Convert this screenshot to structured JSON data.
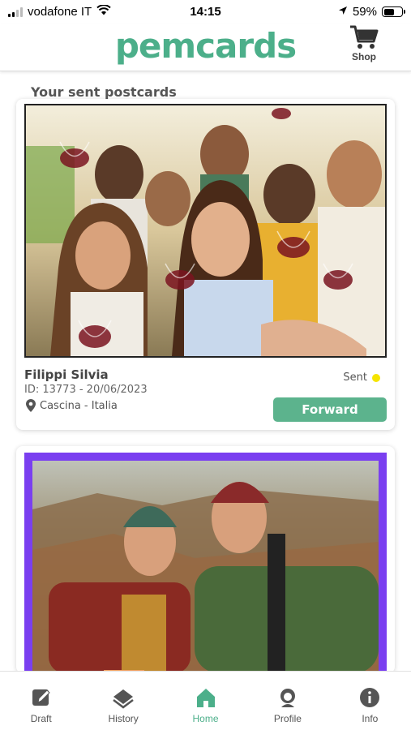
{
  "status_bar": {
    "carrier": "vodafone IT",
    "time": "14:15",
    "battery": "59%",
    "battery_level": 0.59
  },
  "header": {
    "logo": "pemcards",
    "shop_label": "Shop",
    "shop_icon": "cart-icon"
  },
  "section_title": "Your sent postcards",
  "postcards": [
    {
      "name": "Filippi Silvia",
      "id_line": "ID: 13773 - 20/06/2023",
      "location": "Cascina - Italia",
      "status": "Sent",
      "status_color": "#f5e400",
      "forward_label": "Forward"
    },
    {
      "frame_color": "#7a3ff0"
    }
  ],
  "colors": {
    "brand": "#4caf8a",
    "button": "#5cb38d"
  },
  "tabs": [
    {
      "label": "Draft",
      "icon": "edit-icon"
    },
    {
      "label": "History",
      "icon": "history-icon"
    },
    {
      "label": "Home",
      "icon": "home-icon"
    },
    {
      "label": "Profile",
      "icon": "profile-icon"
    },
    {
      "label": "Info",
      "icon": "info-icon"
    }
  ],
  "active_tab": "Home"
}
